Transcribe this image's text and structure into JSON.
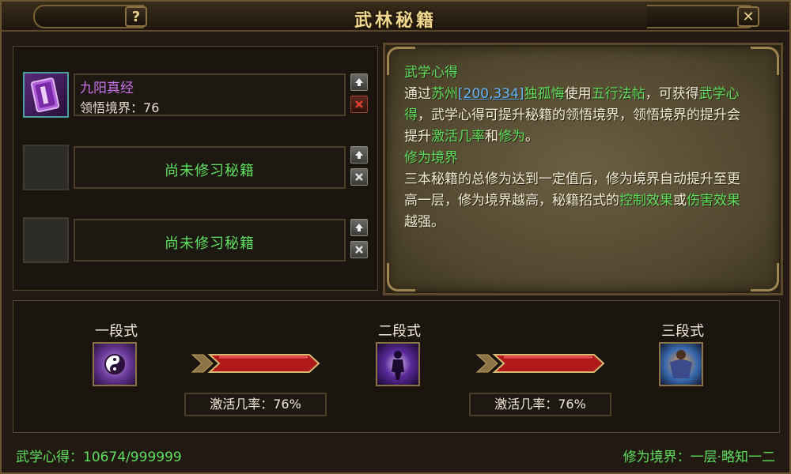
{
  "window": {
    "title": "武林秘籍",
    "help_glyph": "?",
    "close_glyph": "✕"
  },
  "books": [
    {
      "name": "九阳真经",
      "level_label": "领悟境界：",
      "level_value": "76",
      "learned": true
    },
    {
      "empty_label": "尚未修习秘籍",
      "learned": false
    },
    {
      "empty_label": "尚未修习秘籍",
      "learned": false
    }
  ],
  "description": {
    "heading1": "武学心得",
    "p1_a": "通过",
    "p1_place": "苏州",
    "p1_coords": "[200,334]",
    "p1_npc": "独孤悔",
    "p1_b": "使用",
    "p1_item": "五行法帖",
    "p1_c": "，可获得",
    "p1_gain": "武学心得",
    "p1_d": "，武学心得可提升秘籍的领悟境界，领悟境界的提升会提升",
    "p1_rate": "激活几率",
    "p1_and": "和",
    "p1_cultivation": "修为",
    "p1_end": "。",
    "heading2": "修为境界",
    "p2_a": "三本秘籍的总修为达到一定值后，修为境界自动提升至更高一层，修为境界越高，秘籍招式的",
    "p2_control": "控制效果",
    "p2_or": "或",
    "p2_damage": "伤害效果",
    "p2_end": "越强。"
  },
  "stages": [
    {
      "label": "一段式",
      "icon": "yin-yang-icon"
    },
    {
      "label": "二段式",
      "icon": "dark-figure-icon"
    },
    {
      "label": "三段式",
      "icon": "muscle-warrior-icon"
    }
  ],
  "activation": [
    {
      "text": "激活几率：76%"
    },
    {
      "text": "激活几率：76%"
    }
  ],
  "status": {
    "insight": "武学心得：10674/999999",
    "realm": "修为境界：一层·略知一二"
  },
  "colors": {
    "accent_green": "#5ee05e",
    "book_name_purple": "#c873e8",
    "link_blue": "#66b8ff",
    "gold": "#f0d890",
    "bar_red": "#b01a1a"
  }
}
